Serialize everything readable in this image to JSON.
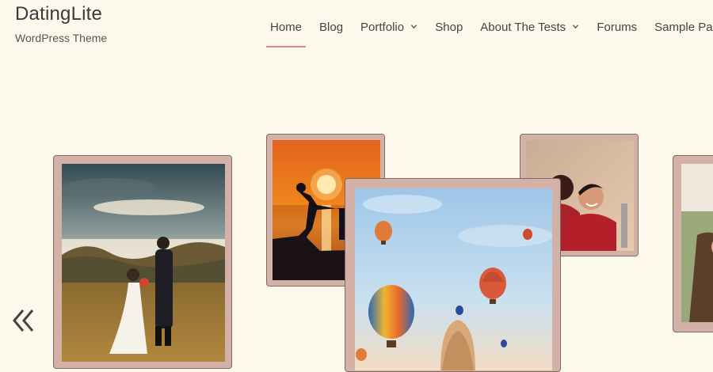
{
  "site": {
    "title": "DatingLite",
    "tagline": "WordPress Theme"
  },
  "nav": {
    "items": [
      {
        "label": "Home",
        "active": true
      },
      {
        "label": "Blog"
      },
      {
        "label": "Portfolio",
        "dropdown": true
      },
      {
        "label": "Shop"
      },
      {
        "label": "About The Tests",
        "dropdown": true
      },
      {
        "label": "Forums"
      },
      {
        "label": "Sample Page"
      }
    ]
  },
  "gallery": {
    "photos": [
      "wedding-couple",
      "sunset-silhouette",
      "hot-air-balloons",
      "smiling-couple",
      "partial-portrait"
    ]
  },
  "colors": {
    "background": "#fdf8ec",
    "accent": "#d98b7d",
    "card_frame": "#d4b1a7"
  },
  "icons": [
    "chevron-down-icon",
    "double-chevron-left-icon"
  ]
}
